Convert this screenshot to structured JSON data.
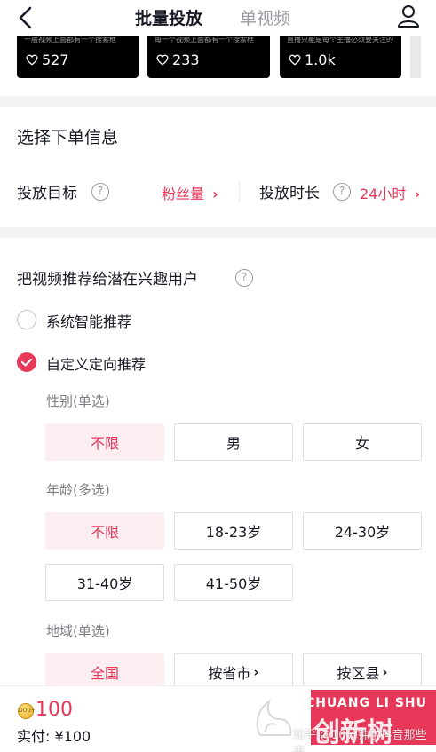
{
  "header": {
    "tab_active": "批量投放",
    "tab_inactive": "单视频"
  },
  "videos": [
    {
      "caption": "一般视频上面都有一个搜索框",
      "likes": "527"
    },
    {
      "caption": "每一个视频上面都有一个搜索框",
      "likes": "233"
    },
    {
      "caption": "直播只能是每个主播必须要关注的",
      "likes": "1.0k"
    }
  ],
  "order_info": {
    "title": "选择下单信息",
    "goal_label": "投放目标",
    "goal_value": "粉丝量",
    "duration_label": "投放时长",
    "duration_value": "24小时",
    "help_glyph": "?"
  },
  "targeting": {
    "title": "把视频推荐给潜在兴趣用户",
    "option_system": "系统智能推荐",
    "option_custom": "自定义定向推荐",
    "gender": {
      "label": "性别(单选)",
      "options": [
        "不限",
        "男",
        "女"
      ],
      "selected": "不限"
    },
    "age": {
      "label": "年龄(多选)",
      "options": [
        "不限",
        "18-23岁",
        "24-30岁",
        "31-40岁",
        "41-50岁"
      ],
      "selected": "不限"
    },
    "region": {
      "label": "地域(单选)",
      "options": [
        "全国",
        "按省市",
        "按区县"
      ],
      "selected": "全国"
    }
  },
  "bottom": {
    "coin_text": "DOU+",
    "amount": "100",
    "paid_label": "实付: ¥100"
  },
  "watermark": {
    "line": "CHUANG LI SHU",
    "big": "创新树",
    "zh": "知乎 @10分钟学抖音那些事"
  },
  "colors": {
    "accent": "#e8385a",
    "selected_bg": "#fdeef1",
    "muted": "#7d7e84"
  }
}
